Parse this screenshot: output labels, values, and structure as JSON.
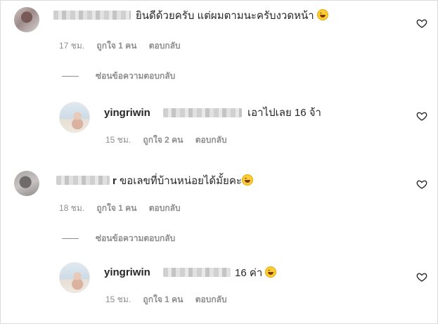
{
  "comments": [
    {
      "text": "ยินดีด้วยครับ แต่ผมตามนะครับงวดหน้า",
      "time": "17 ชม.",
      "likes": "ถูกใจ 1 คน",
      "reply": "ตอบกลับ",
      "hide_replies": "ซ่อนข้อความตอบกลับ",
      "reply_item": {
        "username": "yingriwin",
        "text": "เอาไปเลย 16 จ้า",
        "time": "15 ชม.",
        "likes": "ถูกใจ 2 คน",
        "reply": "ตอบกลับ"
      }
    },
    {
      "username_tail": "r",
      "text": "ขอเลขที่บ้านหน่อยได้มั้ยคะ",
      "time": "18 ชม.",
      "likes": "ถูกใจ 1 คน",
      "reply": "ตอบกลับ",
      "hide_replies": "ซ่อนข้อความตอบกลับ",
      "reply_item": {
        "username": "yingriwin",
        "text": "16 ค่า",
        "time": "15 ชม.",
        "likes": "ถูกใจ 1 คน",
        "reply": "ตอบกลับ"
      }
    }
  ]
}
